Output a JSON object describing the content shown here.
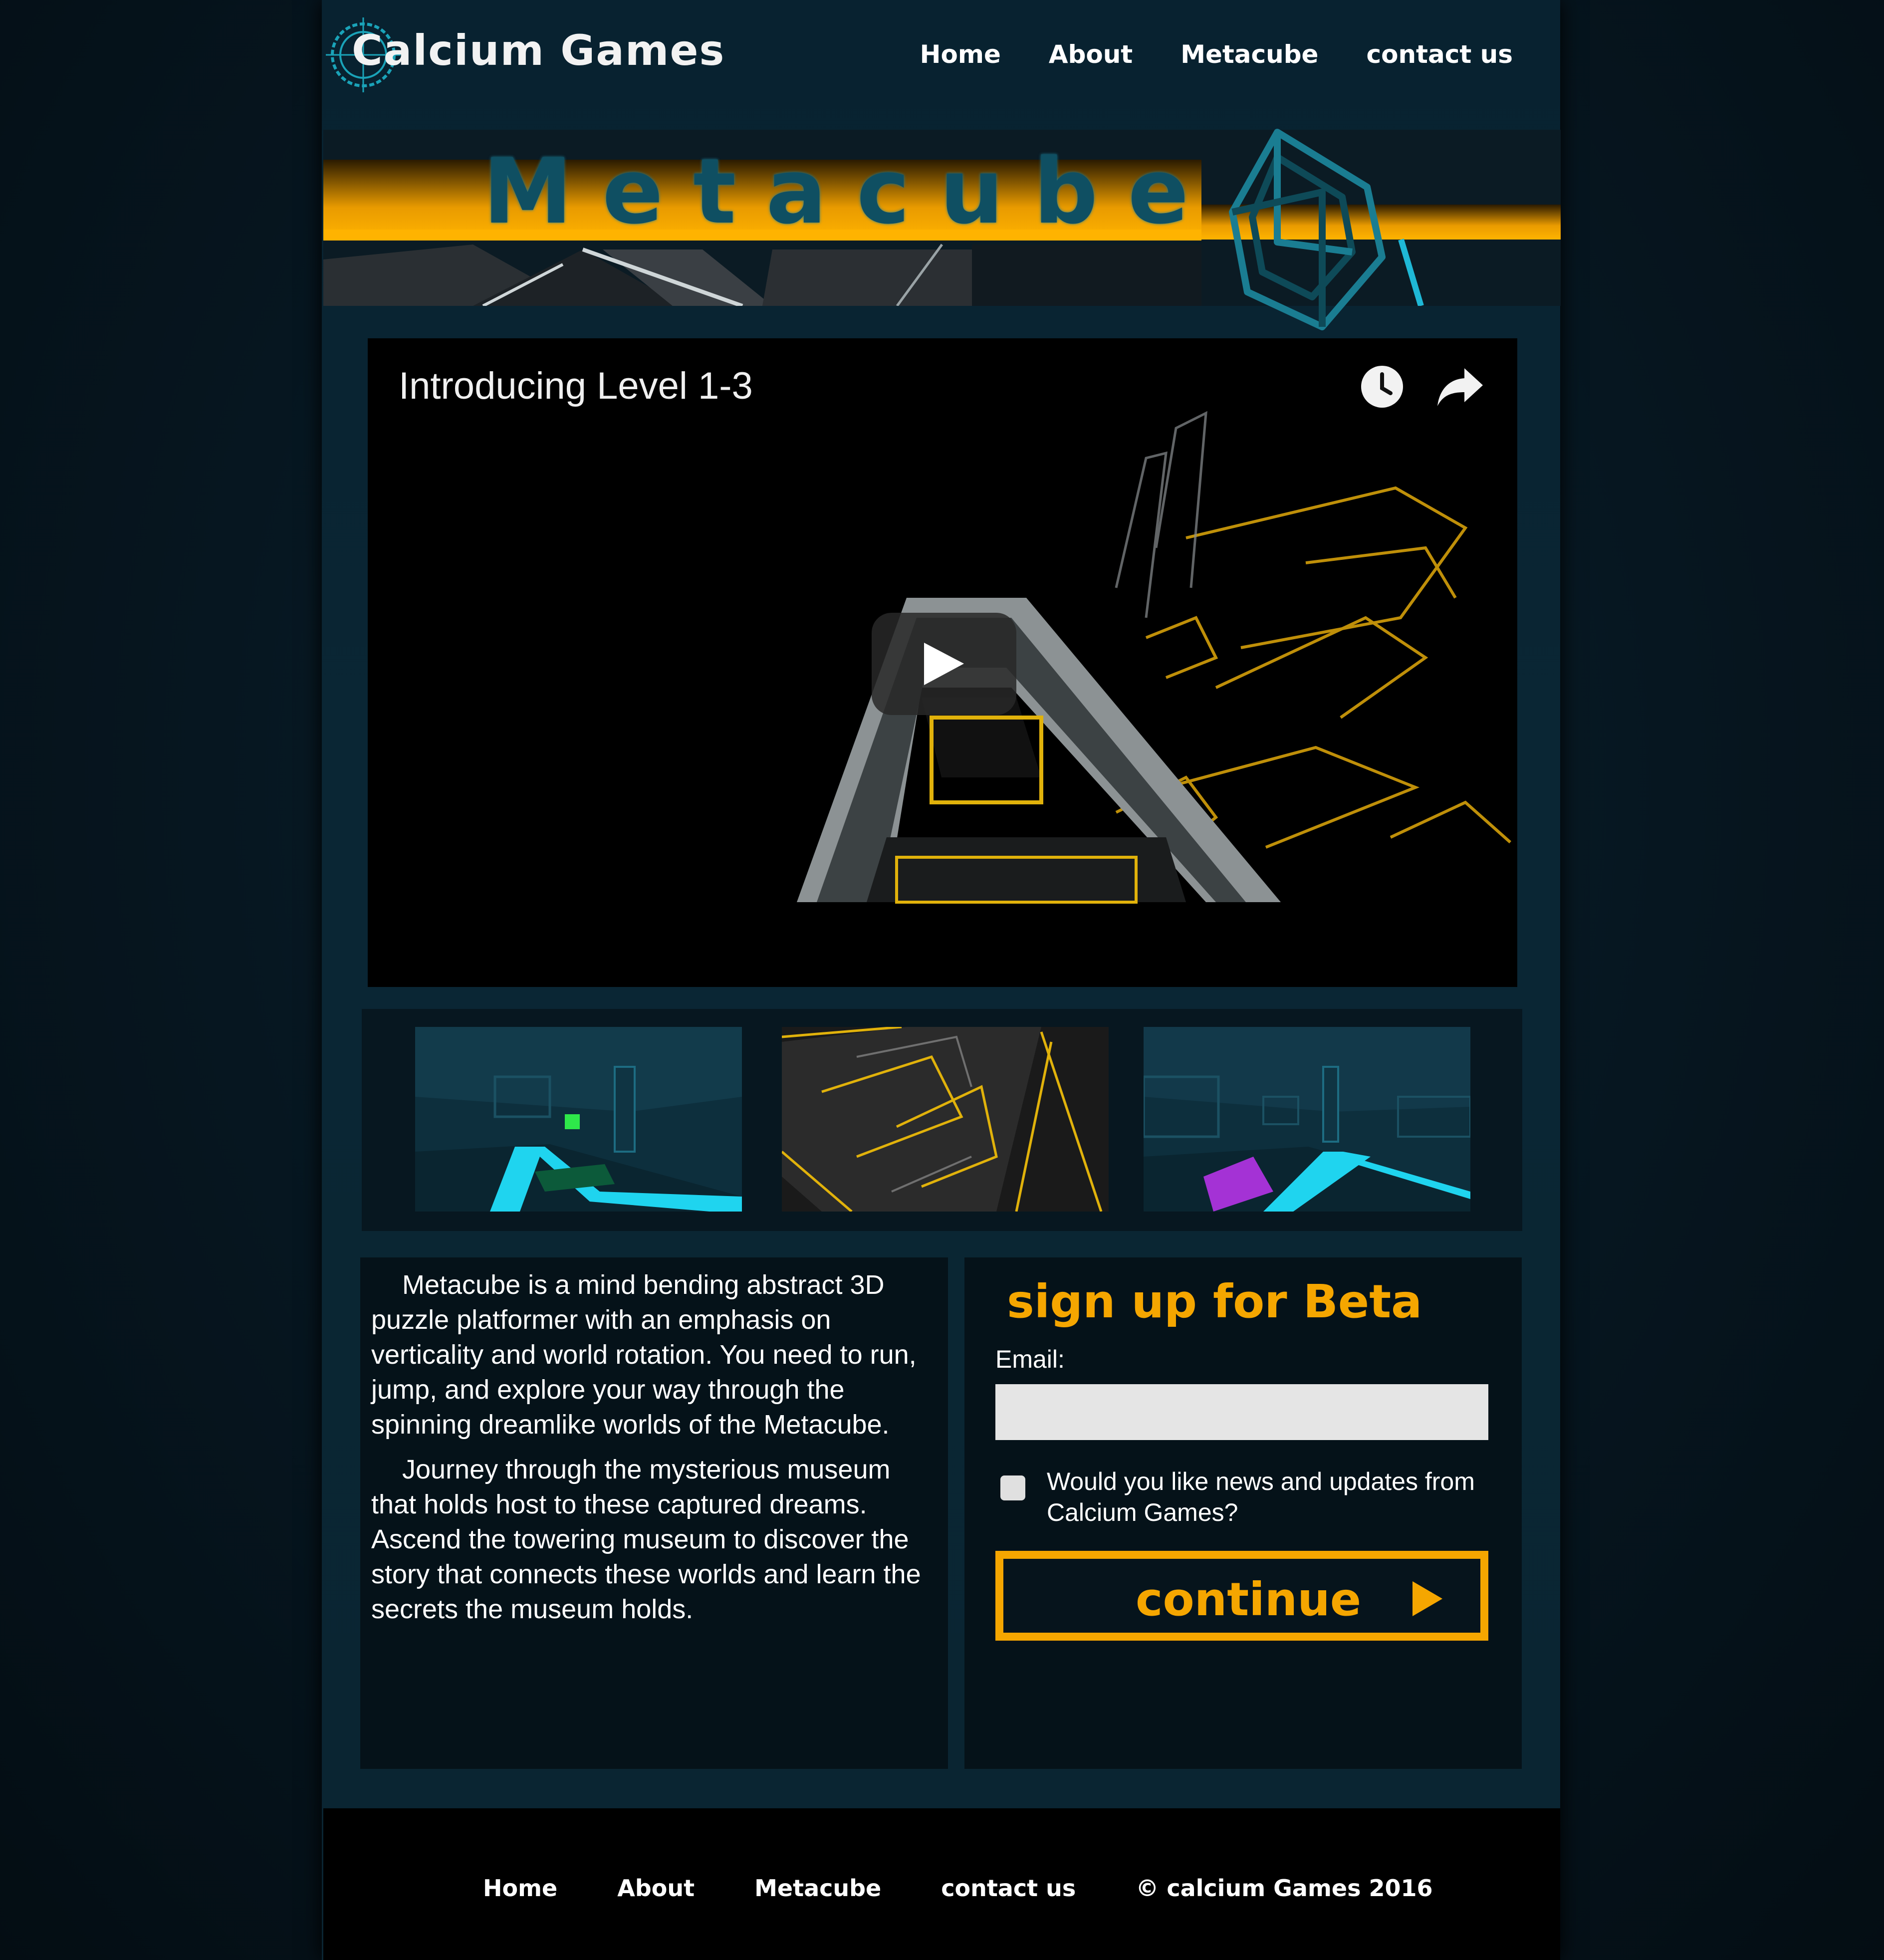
{
  "brand": {
    "name": "Calcium Games"
  },
  "nav": {
    "items": [
      "Home",
      "About",
      "Metacube",
      "contact us"
    ]
  },
  "banner": {
    "title": "Metacube"
  },
  "video": {
    "title": "Introducing Level 1-3"
  },
  "thumbnails": [
    "thumbnail-1",
    "thumbnail-2",
    "thumbnail-3"
  ],
  "about": {
    "paragraphs": [
      "Metacube is a mind bending abstract 3D puzzle platformer with an emphasis on verticality and world rotation. You need to run, jump, and explore your way through the spinning dreamlike worlds of the Metacube.",
      "Journey through the mysterious museum that holds host to these captured dreams. Ascend the towering museum to discover the story that connects these worlds and learn the secrets the museum holds."
    ]
  },
  "signup": {
    "title": "sign up for Beta",
    "email_label": "Email:",
    "email_value": "",
    "news_label": "Would you like news and updates from Calcium Games?",
    "continue_label": "continue"
  },
  "footer": {
    "items": [
      "Home",
      "About",
      "Metacube",
      "contact us",
      "© calcium Games 2016"
    ]
  },
  "colors": {
    "accent": "#f5a600",
    "background": "#06141c",
    "cyan": "#1fb8d6"
  }
}
